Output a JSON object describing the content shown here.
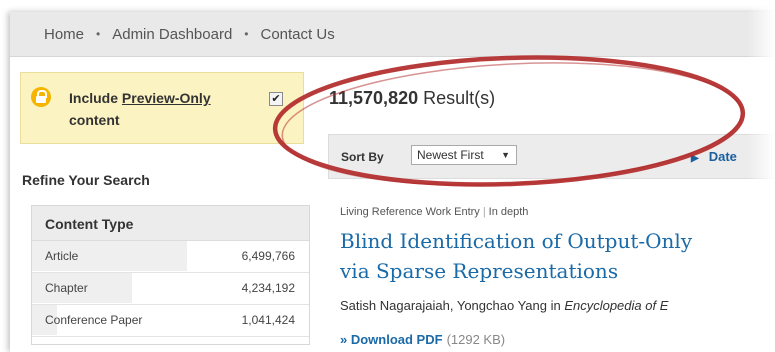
{
  "nav": {
    "home": "Home",
    "admin": "Admin Dashboard",
    "contact": "Contact Us",
    "separator": "•"
  },
  "preview": {
    "label_before": "Include ",
    "label_link": "Preview-Only",
    "label_after": " content",
    "checked": true,
    "check_glyph": "✔"
  },
  "refine": {
    "title": "Refine Your Search"
  },
  "content_type": {
    "title": "Content Type",
    "rows": [
      {
        "label": "Article",
        "count": "6,499,766",
        "fraction": 0.56
      },
      {
        "label": "Chapter",
        "count": "4,234,192",
        "fraction": 0.36
      },
      {
        "label": "Conference Paper",
        "count": "1,041,424",
        "fraction": 0.09
      }
    ]
  },
  "results": {
    "count": "11,570,820",
    "suffix": " Result(s)"
  },
  "sort": {
    "label": "Sort By",
    "selected": "Newest First",
    "caret": "▼",
    "date_label": "Date",
    "date_icon": "▶"
  },
  "entry": {
    "type": "Living Reference Work Entry",
    "depth": "In depth",
    "title_line1": "Blind Identification of Output-Only",
    "title_line2": "via Sparse Representations",
    "authors": "Satish Nagarajaiah, Yongchao Yang in ",
    "publication": "Encyclopedia of E",
    "download_label": "» Download PDF",
    "download_size": "(1292 KB)"
  },
  "colors": {
    "annotation": "#b22a2a",
    "link": "#1a6aa8",
    "preview_bg": "#fcf3c2"
  },
  "icons": {
    "lock": "lock-icon",
    "check": "checkmark-icon",
    "caret": "chevron-down-icon",
    "expand": "triangle-right-icon"
  }
}
